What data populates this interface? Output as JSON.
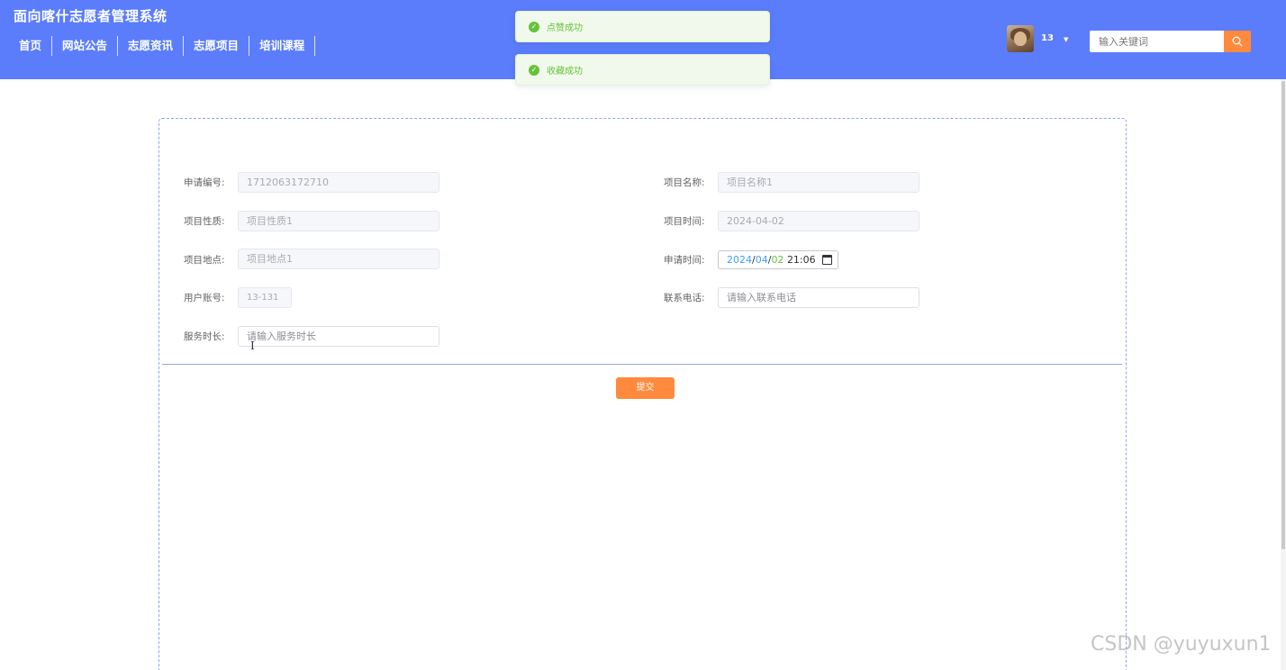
{
  "header": {
    "title": "面向喀什志愿者管理系统",
    "nav": [
      "首页",
      "网站公告",
      "志愿资讯",
      "志愿项目",
      "培训课程"
    ],
    "user_name": "13",
    "search_placeholder": "输入关键词"
  },
  "toasts": [
    {
      "message": "点赞成功"
    },
    {
      "message": "收藏成功"
    }
  ],
  "form": {
    "application_no": {
      "label": "申请编号:",
      "value": "1712063172710"
    },
    "project_name": {
      "label": "项目名称:",
      "value": "项目名称1"
    },
    "project_nature": {
      "label": "项目性质:",
      "value": "项目性质1"
    },
    "project_time": {
      "label": "项目时间:",
      "value": "2024-04-02"
    },
    "project_location": {
      "label": "项目地点:",
      "value": "项目地点1"
    },
    "apply_time": {
      "label": "申请时间:",
      "year": "2024",
      "month": "04",
      "day": "02",
      "time": "21:06"
    },
    "user_account": {
      "label": "用户账号:",
      "value": "13-131"
    },
    "phone": {
      "label": "联系电话:",
      "placeholder": "请输入联系电话"
    },
    "service_hours": {
      "label": "服务时长:",
      "placeholder": "请输入服务时长"
    },
    "submit_label": "提交"
  },
  "watermark": "CSDN @yuyuxun1",
  "colors": {
    "header_bg": "#5b7dfc",
    "accent": "#ff8a3d",
    "success": "#67c23a",
    "panel_border": "#93a2e8"
  }
}
